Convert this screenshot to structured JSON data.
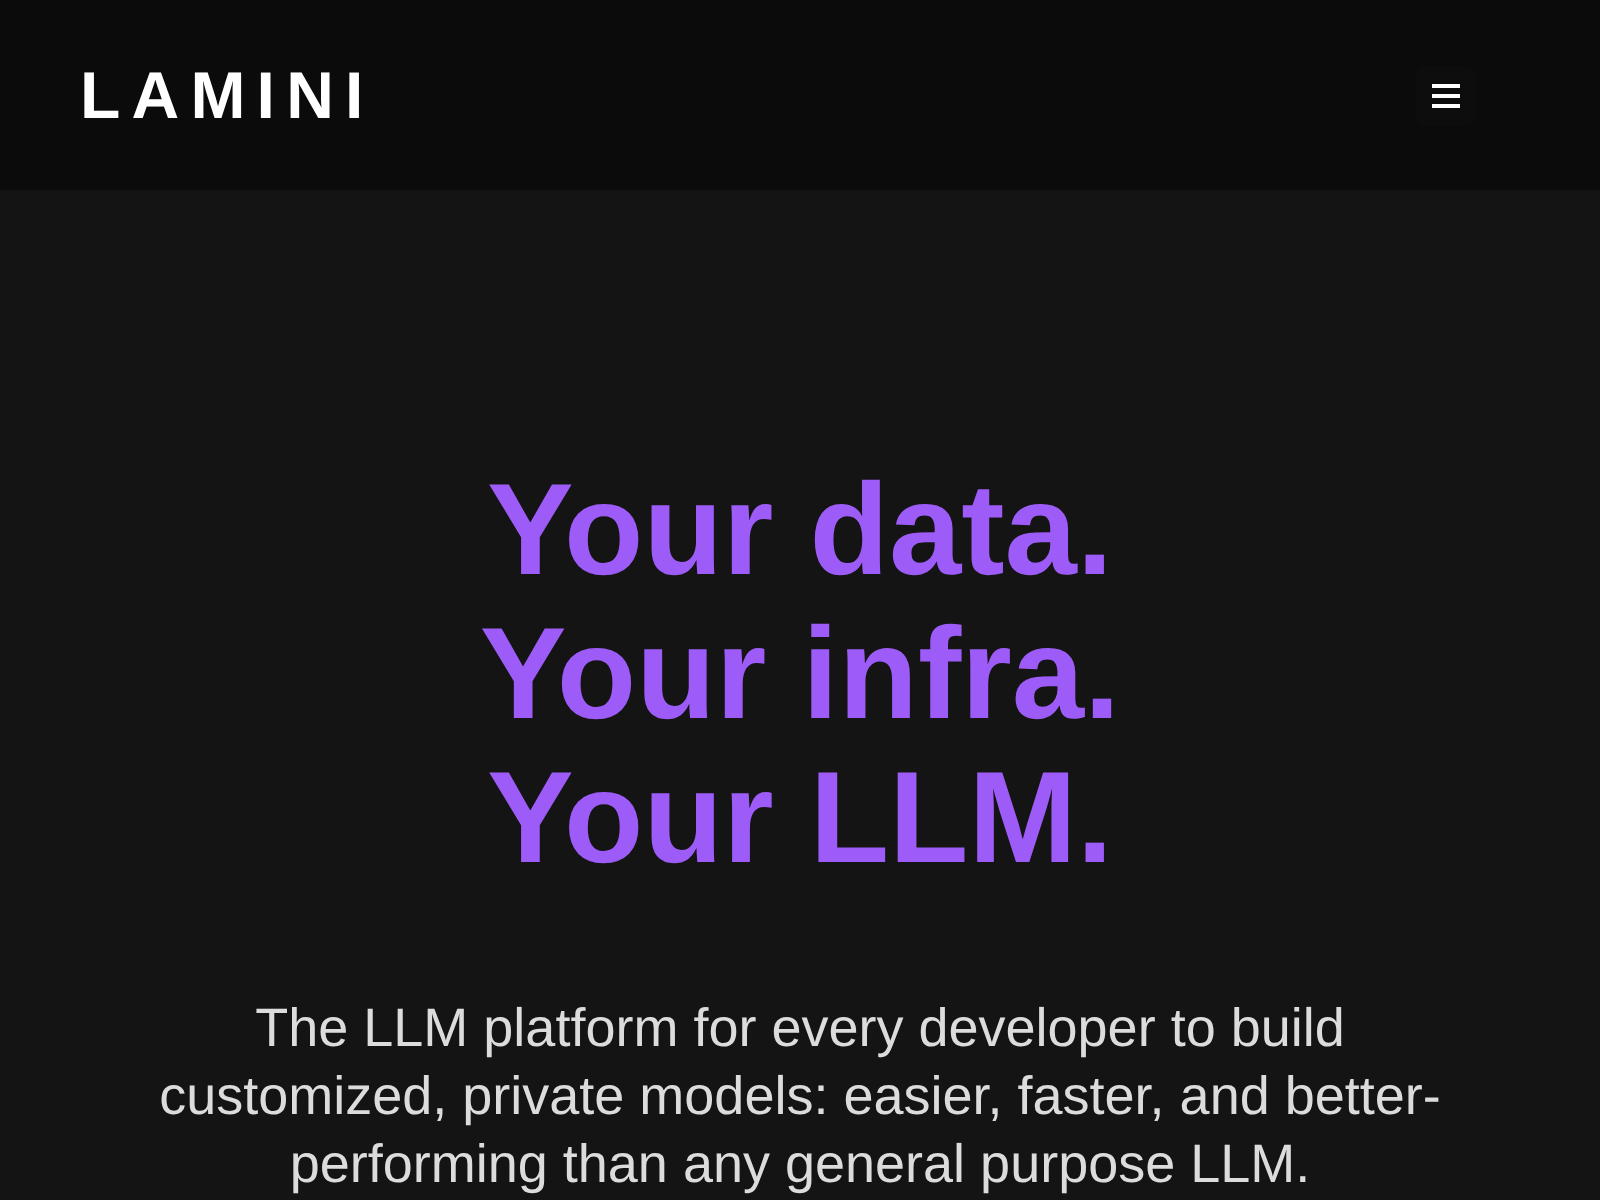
{
  "header": {
    "logo": "LAMINI"
  },
  "hero": {
    "headline": [
      "Your data.",
      "Your infra.",
      "Your LLM."
    ],
    "subtitle": "The LLM platform for every developer to build customized, private models: easier, faster, and better-performing than any general purpose LLM."
  }
}
